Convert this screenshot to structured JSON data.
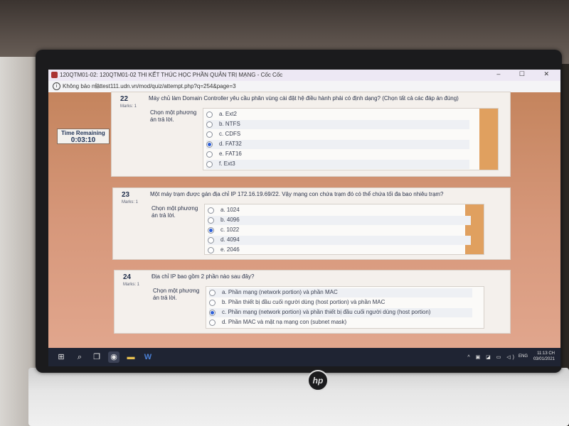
{
  "window": {
    "title": "120QTM01-02: 120QTM01-02 THI KẾT THÚC HỌC PHẦN QUẢN TRỊ MẠNG - Cốc Cốc",
    "controls": "–  ☐  ✕"
  },
  "address_bar": {
    "security_label": "Không bảo mật",
    "separator": "|",
    "url": "test111.udn.vn/mod/quiz/attempt.php?q=254&page=3"
  },
  "timer": {
    "label": "Time Remaining",
    "value": "0:03:10"
  },
  "questions": [
    {
      "number": "22",
      "marks": "Marks: 1",
      "text": "Máy chủ làm Domain Controller yêu cầu phân vùng cài đặt hệ điều hành phải có định dạng? (Chọn tất cả các đáp án đúng)",
      "prompt": "Chọn một phương án trả lời.",
      "options": [
        {
          "label": "a. Ext2",
          "selected": false
        },
        {
          "label": "b. NTFS",
          "selected": false
        },
        {
          "label": "c. CDFS",
          "selected": false
        },
        {
          "label": "d. FAT32",
          "selected": true
        },
        {
          "label": "e. FAT16",
          "selected": false
        },
        {
          "label": "f. Ext3",
          "selected": false
        }
      ]
    },
    {
      "number": "23",
      "marks": "Marks: 1",
      "text": "Một máy trạm được gán địa chỉ IP 172.16.19.69/22. Vậy mạng con chứa trạm đó có thể chứa tối đa bao nhiêu trạm?",
      "prompt": "Chọn một phương án trả lời.",
      "options": [
        {
          "label": "a. 1024",
          "selected": false
        },
        {
          "label": "b. 4096",
          "selected": false
        },
        {
          "label": "c. 1022",
          "selected": true
        },
        {
          "label": "d. 4094",
          "selected": false
        },
        {
          "label": "e. 2046",
          "selected": false
        }
      ]
    },
    {
      "number": "24",
      "marks": "Marks: 1",
      "text": "Địa chỉ IP bao gồm 2 phần nào sau đây?",
      "prompt": "Chọn một phương án trả lời.",
      "options": [
        {
          "label": "a. Phần mạng (network portion) và phần MAC",
          "selected": false
        },
        {
          "label": "b. Phần thiết bị đầu cuối người dùng (host portion) và phần MAC",
          "selected": false
        },
        {
          "label": "c. Phần mạng (network portion) và phần thiết bị đầu cuối người dùng (host portion)",
          "selected": true
        },
        {
          "label": "d. Phần MAC và mặt nạ mạng con (subnet mask)",
          "selected": false
        }
      ]
    }
  ],
  "taskbar": {
    "language": "ENG",
    "time": "11:13 CH",
    "date": "03/01/2021",
    "apps": [
      "windows-start-icon",
      "search-icon",
      "task-view-icon",
      "coccoc-browser-icon",
      "file-explorer-icon",
      "word-icon"
    ]
  },
  "device": {
    "brand_logo": "hp"
  }
}
